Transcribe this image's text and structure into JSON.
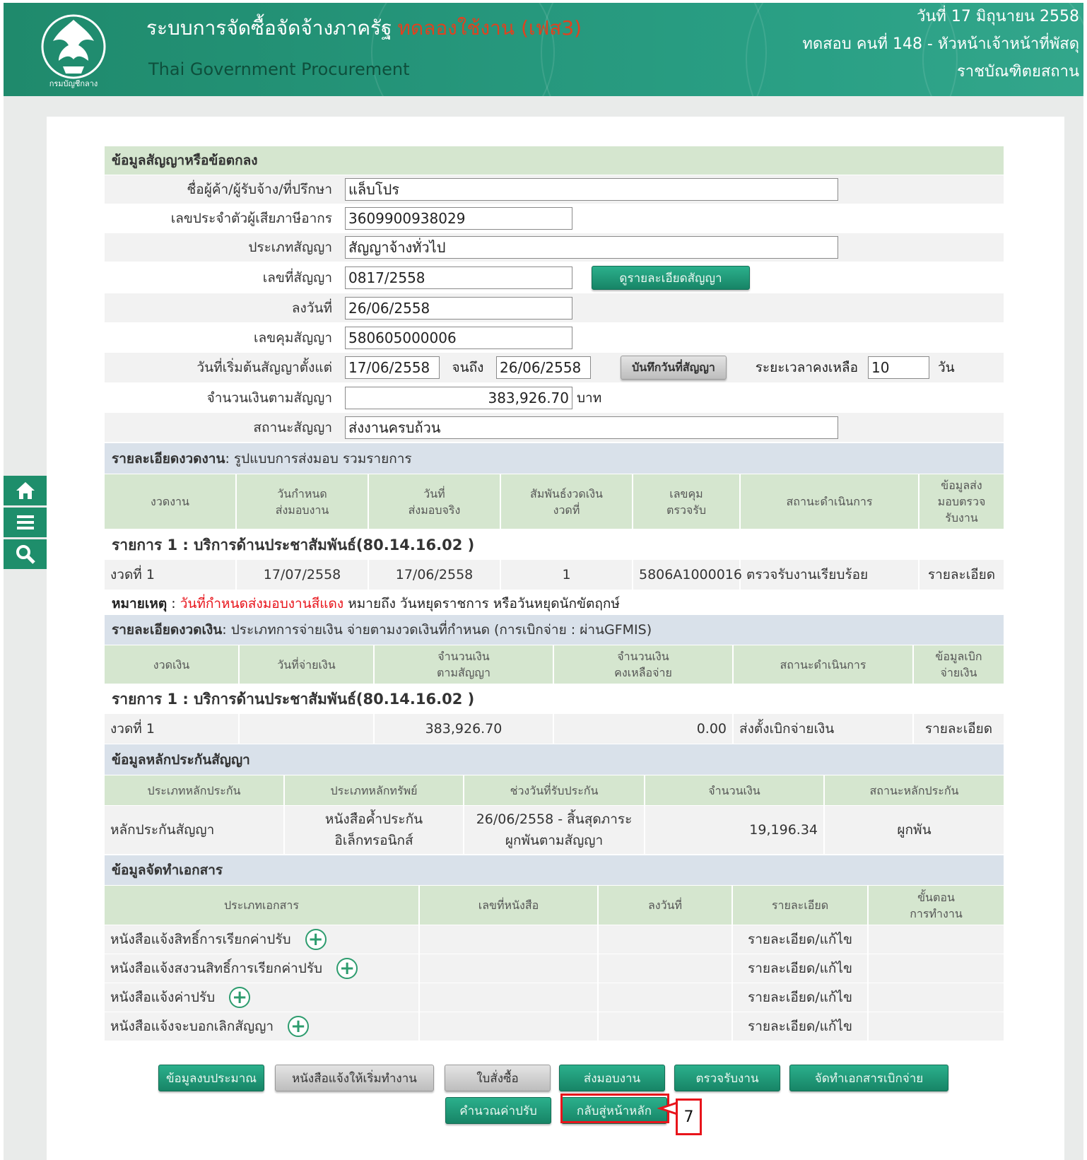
{
  "header": {
    "title": "ระบบการจัดซื้อจัดจ้างภาครัฐ",
    "trial_label": "ทดลองใช้งาน (เฟส3)",
    "subtitle": "Thai Government Procurement",
    "date": "วันที่ 17 มิถุนายน 2558",
    "user": "ทดสอบ คนที่ 148 - หัวหน้าเจ้าหน้าที่พัสดุ",
    "org": "ราชบัณฑิตยสถาน",
    "logo_text": "กรมบัญชีกลาง"
  },
  "side_tools": [
    "home-icon",
    "menu-icon",
    "search-icon"
  ],
  "contract": {
    "section_title": "ข้อมูลสัญญาหรือข้อตกลง",
    "vendor_label": "ชื่อผู้ค้า/ผู้รับจ้าง/ที่ปรึกษา",
    "vendor_value": "แล็บโปร",
    "tax_label": "เลขประจำตัวผู้เสียภาษีอากร",
    "tax_value": "3609900938029",
    "type_label": "ประเภทสัญญา",
    "type_value": "สัญญาจ้างทั่วไป",
    "number_label": "เลขที่สัญญา",
    "number_value": "0817/2558",
    "view_button": "ดูรายละเอียดสัญญา",
    "sign_date_label": "ลงวันที่",
    "sign_date_value": "26/06/2558",
    "control_label": "เลขคุมสัญญา",
    "control_value": "580605000006",
    "start_label": "วันที่เริ่มต้นสัญญาตั้งแต่",
    "start_value": "17/06/2558",
    "until_label": "จนถึง",
    "end_value": "26/06/2558",
    "save_date_button": "บันทึกวันที่สัญญา",
    "remaining_label": "ระยะเวลาคงเหลือ",
    "remaining_value": "10",
    "remaining_unit": "วัน",
    "amount_label": "จำนวนเงินตามสัญญา",
    "amount_value": "383,926.70",
    "amount_unit": "บาท",
    "status_label": "สถานะสัญญา",
    "status_value": "ส่งงานครบถ้วน"
  },
  "delivery": {
    "section_title": "รายละเอียดงวดงาน",
    "section_detail": " : รูปแบบการส่งมอบ รวมรายการ",
    "headers": [
      "งวดงาน",
      "วันกำหนด\nส่งมอบงาน",
      "วันที่\nส่งมอบจริง",
      "สัมพันธ์งวดเงิน\nงวดที่",
      "เลขคุม\nตรวจรับ",
      "สถานะดำเนินการ",
      "ข้อมูลส่ง\nมอบตรวจ\nรับงาน"
    ],
    "item_title": "รายการ 1 : บริการด้านประชาสัมพันธ์(80.14.16.02 )",
    "rows": [
      [
        "งวดที่ 1",
        "17/07/2558",
        "17/06/2558",
        "1",
        "5806A1000016",
        "ตรวจรับงานเรียบร้อย",
        "รายละเอียด"
      ]
    ],
    "note_label": "หมายเหตุ",
    "note_red": "วันที่กำหนดส่งมอบงานสีแดง",
    "note_rest": "หมายถึง วันหยุดราชการ หรือวันหยุดนักขัตฤกษ์"
  },
  "payment": {
    "section_title": "รายละเอียดงวดเงิน",
    "section_detail": " : ประเภทการจ่ายเงิน จ่ายตามงวดเงินที่กำหนด (การเบิกจ่าย : ผ่านGFMIS)",
    "headers": [
      "งวดเงิน",
      "วันที่จ่ายเงิน",
      "จำนวนเงิน\nตามสัญญา",
      "จำนวนเงิน\nคงเหลือจ่าย",
      "สถานะดำเนินการ",
      "ข้อมูลเบิก\nจ่ายเงิน"
    ],
    "item_title": "รายการ 1 : บริการด้านประชาสัมพันธ์(80.14.16.02 )",
    "rows": [
      [
        "งวดที่ 1",
        "",
        "383,926.70",
        "0.00",
        "ส่งตั้งเบิกจ่ายเงิน",
        "รายละเอียด"
      ]
    ]
  },
  "guarantee": {
    "section_title": "ข้อมูลหลักประกันสัญญา",
    "headers": [
      "ประเภทหลักประกัน",
      "ประเภทหลักทรัพย์",
      "ช่วงวันที่รับประกัน",
      "จำนวนเงิน",
      "สถานะหลักประกัน"
    ],
    "rows": [
      [
        "หลักประกันสัญญา",
        "หนังสือค้ำประกัน\nอิเล็กทรอนิกส์",
        "26/06/2558 - สิ้นสุดภาระ\nผูกพันตามสัญญา",
        "19,196.34",
        "ผูกพัน"
      ]
    ]
  },
  "documents": {
    "section_title": "ข้อมูลจัดทำเอกสาร",
    "headers": [
      "ประเภทเอกสาร",
      "เลขที่หนังสือ",
      "ลงวันที่",
      "รายละเอียด",
      "ขั้นตอน\nการทำงาน"
    ],
    "rows": [
      {
        "type": "หนังสือแจ้งสิทธิ์การเรียกค่าปรับ",
        "link": "รายละเอียด/แก้ไข"
      },
      {
        "type": "หนังสือแจ้งสงวนสิทธิ์การเรียกค่าปรับ",
        "link": "รายละเอียด/แก้ไข"
      },
      {
        "type": "หนังสือแจ้งค่าปรับ",
        "link": "รายละเอียด/แก้ไข"
      },
      {
        "type": "หนังสือแจ้งจะบอกเลิกสัญญา",
        "link": "รายละเอียด/แก้ไข"
      }
    ]
  },
  "actions": {
    "budget": "ข้อมูลงบประมาณ",
    "start_letter": "หนังสือแจ้งให้เริ่มทำงาน",
    "purchase_order": "ใบสั่งซื้อ",
    "deliver": "ส่งมอบงาน",
    "inspect": "ตรวจรับงาน",
    "disburse_docs": "จัดทำเอกสารเบิกจ่าย",
    "calc_penalty": "คำนวณค่าปรับ",
    "back_home": "กลับสู่หน้าหลัก"
  },
  "annotation": {
    "step_number": "7",
    "color": "#e8141b"
  },
  "colors": {
    "brand": "#1f8a6c",
    "section_green": "#d5e6cf",
    "section_blue": "#d9e1ea",
    "link": "#7a9fc8",
    "note_red": "#e8141b"
  }
}
